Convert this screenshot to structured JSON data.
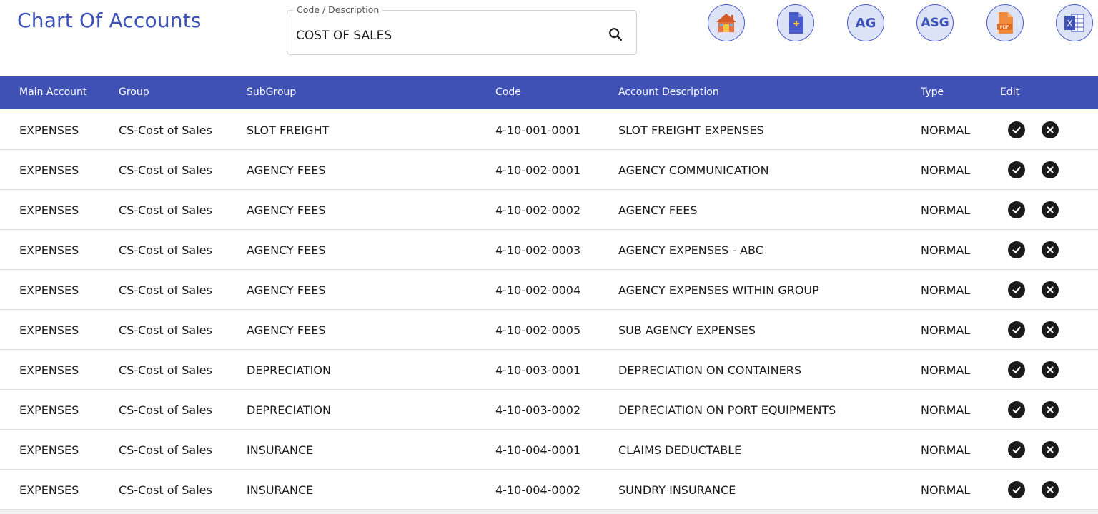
{
  "header": {
    "title": "Chart Of Accounts"
  },
  "search": {
    "label": "Code / Description",
    "value": "COST OF SALES",
    "icon": "search-icon"
  },
  "toolbar": {
    "home_icon": "home-icon",
    "new_icon": "new-document-icon",
    "ag_label": "AG",
    "asg_label": "ASG",
    "pdf_label": "PDF",
    "excel_label": "X"
  },
  "colors": {
    "accent": "#3f51b5",
    "title": "#3d52b8",
    "button_bg": "#dde3f7"
  },
  "table": {
    "headers": {
      "main_account": "Main Account",
      "group": "Group",
      "subgroup": "SubGroup",
      "code": "Code",
      "description": "Account Description",
      "type": "Type",
      "edit": "Edit"
    },
    "rows": [
      {
        "main": "EXPENSES",
        "group": "CS-Cost of Sales",
        "subgroup": "SLOT FREIGHT",
        "code": "4-10-001-0001",
        "description": "SLOT FREIGHT EXPENSES",
        "type": "NORMAL"
      },
      {
        "main": "EXPENSES",
        "group": "CS-Cost of Sales",
        "subgroup": "AGENCY FEES",
        "code": "4-10-002-0001",
        "description": "AGENCY COMMUNICATION",
        "type": "NORMAL"
      },
      {
        "main": "EXPENSES",
        "group": "CS-Cost of Sales",
        "subgroup": "AGENCY FEES",
        "code": "4-10-002-0002",
        "description": "AGENCY FEES",
        "type": "NORMAL"
      },
      {
        "main": "EXPENSES",
        "group": "CS-Cost of Sales",
        "subgroup": "AGENCY FEES",
        "code": "4-10-002-0003",
        "description": "AGENCY EXPENSES - ABC",
        "type": "NORMAL"
      },
      {
        "main": "EXPENSES",
        "group": "CS-Cost of Sales",
        "subgroup": "AGENCY FEES",
        "code": "4-10-002-0004",
        "description": "AGENCY EXPENSES WITHIN GROUP",
        "type": "NORMAL"
      },
      {
        "main": "EXPENSES",
        "group": "CS-Cost of Sales",
        "subgroup": "AGENCY FEES",
        "code": "4-10-002-0005",
        "description": "SUB AGENCY EXPENSES",
        "type": "NORMAL"
      },
      {
        "main": "EXPENSES",
        "group": "CS-Cost of Sales",
        "subgroup": "DEPRECIATION",
        "code": "4-10-003-0001",
        "description": "DEPRECIATION ON CONTAINERS",
        "type": "NORMAL"
      },
      {
        "main": "EXPENSES",
        "group": "CS-Cost of Sales",
        "subgroup": "DEPRECIATION",
        "code": "4-10-003-0002",
        "description": "DEPRECIATION ON PORT EQUIPMENTS",
        "type": "NORMAL"
      },
      {
        "main": "EXPENSES",
        "group": "CS-Cost of Sales",
        "subgroup": "INSURANCE",
        "code": "4-10-004-0001",
        "description": "CLAIMS DEDUCTABLE",
        "type": "NORMAL"
      },
      {
        "main": "EXPENSES",
        "group": "CS-Cost of Sales",
        "subgroup": "INSURANCE",
        "code": "4-10-004-0002",
        "description": "SUNDRY INSURANCE",
        "type": "NORMAL"
      }
    ]
  }
}
